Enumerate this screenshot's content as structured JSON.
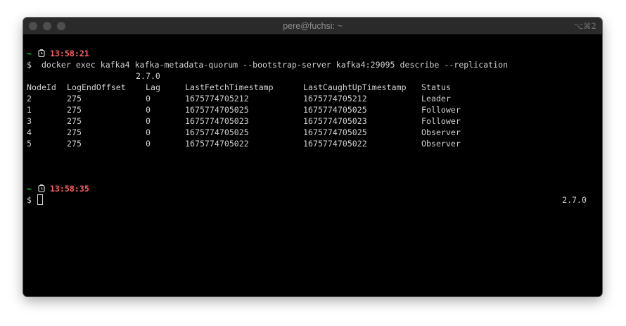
{
  "window": {
    "title": "pere@fuchsi: ~",
    "shortcut": "⌥⌘2"
  },
  "terminal": {
    "prompt1": {
      "tilde": "~",
      "icon": "clock-icon",
      "time": "13:58:21"
    },
    "command": {
      "symbol": "$",
      "text": "docker exec kafka4 kafka-metadata-quorum --bootstrap-server kafka4:29095 describe --replication"
    },
    "version_inline": "2.7.0",
    "table": {
      "headers": [
        "NodeId",
        "LogEndOffset",
        "Lag",
        "LastFetchTimestamp",
        "LastCaughtUpTimestamp",
        "Status"
      ],
      "rows": [
        [
          "2",
          "275",
          "0",
          "1675774705212",
          "1675774705212",
          "Leader"
        ],
        [
          "1",
          "275",
          "0",
          "1675774705025",
          "1675774705025",
          "Follower"
        ],
        [
          "3",
          "275",
          "0",
          "1675774705023",
          "1675774705023",
          "Follower"
        ],
        [
          "4",
          "275",
          "0",
          "1675774705025",
          "1675774705025",
          "Observer"
        ],
        [
          "5",
          "275",
          "0",
          "1675774705022",
          "1675774705022",
          "Observer"
        ]
      ]
    },
    "prompt2": {
      "tilde": "~",
      "icon": "clock-icon",
      "time": "13:58:35"
    },
    "input_line": {
      "symbol": "$",
      "value": ""
    },
    "version_right": "2.7.0"
  },
  "colors": {
    "background": "#000000",
    "text": "#d2d2d2",
    "tilde": "#34d04a",
    "time": "#ff5f5f",
    "titlebar": "#2a2a2a"
  }
}
